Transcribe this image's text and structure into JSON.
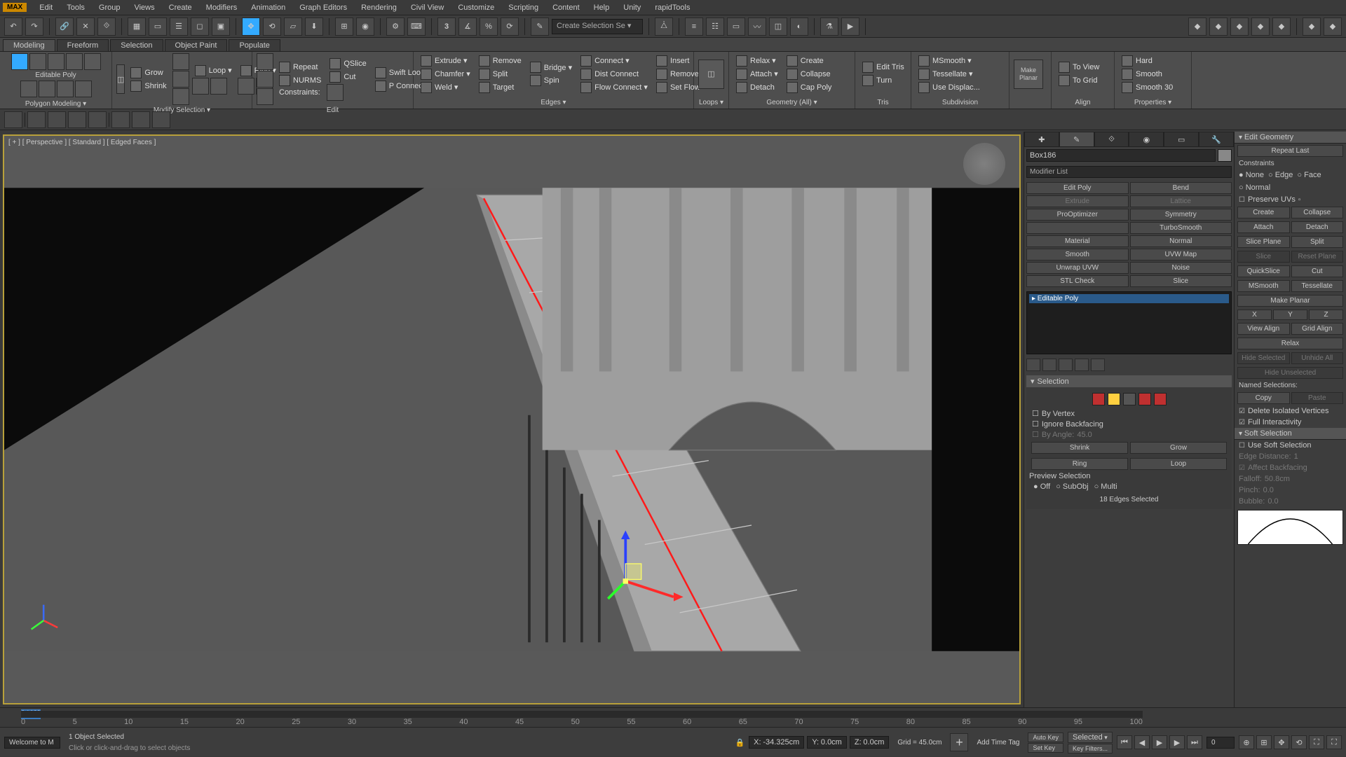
{
  "menu": {
    "logo": "MAX",
    "items": [
      "Edit",
      "Tools",
      "Group",
      "Views",
      "Create",
      "Modifiers",
      "Animation",
      "Graph Editors",
      "Rendering",
      "Civil View",
      "Customize",
      "Scripting",
      "Content",
      "Help",
      "Unity",
      "rapidTools"
    ]
  },
  "toolbar": {
    "selection_set_placeholder": "Create Selection Se"
  },
  "tabs": {
    "items": [
      "Modeling",
      "Freeform",
      "Selection",
      "Object Paint",
      "Populate"
    ],
    "active": 0
  },
  "ribbon": {
    "polygon_modeling": {
      "label": "Polygon Modeling ▾",
      "mode": "Editable Poly"
    },
    "modify": {
      "label": "Modify Selection ▾",
      "grow": "Grow",
      "shrink": "Shrink",
      "loop": "Loop ▾",
      "ring": "Ring ▾"
    },
    "edit": {
      "label": "Edit",
      "repeat": "Repeat",
      "nurms": "NURMS",
      "constraints": "Constraints:",
      "qslice": "QSlice",
      "cut": "Cut",
      "swiftloop": "Swift Loop",
      "pconnect": "P Connect ▾"
    },
    "edges": {
      "label": "Edges ▾",
      "extrude": "Extrude ▾",
      "chamfer": "Chamfer ▾",
      "weld": "Weld ▾",
      "remove": "Remove",
      "split": "Split",
      "target": "Target",
      "bridge": "Bridge ▾",
      "spin": "Spin",
      "connect": "Connect ▾",
      "distconnect": "Dist Connect",
      "flowconnect": "Flow Connect ▾",
      "insert": "Insert",
      "remove2": "Remove",
      "setflow": "Set Flow"
    },
    "loops": {
      "label": "Loops ▾"
    },
    "geometry": {
      "label": "Geometry (All) ▾",
      "relax": "Relax ▾",
      "attach": "Attach ▾",
      "detach": "Detach",
      "create": "Create",
      "collapse": "Collapse",
      "cappoly": "Cap Poly"
    },
    "tris": {
      "label": "Tris",
      "edittris": "Edit Tris",
      "turn": "Turn"
    },
    "subdivision": {
      "label": "Subdivision",
      "msmooth": "MSmooth ▾",
      "tessellate": "Tessellate ▾",
      "usedisplac": "Use Displac..."
    },
    "make_planar": {
      "label": "Make Planar",
      "btn": "Make\nPlanar"
    },
    "align": {
      "label": "Align",
      "toview": "To View",
      "togrid": "To Grid"
    },
    "properties": {
      "label": "Properties ▾",
      "hard": "Hard",
      "smooth": "Smooth",
      "smooth30": "Smooth 30"
    }
  },
  "viewport": {
    "label": "[ + ] [ Perspective ] [ Standard ] [ Edged Faces ]"
  },
  "modify_panel": {
    "object_name": "Box186",
    "modifier_list_label": "Modifier List",
    "modifier_buttons": [
      "Edit Poly",
      "Bend",
      "Extrude",
      "Lattice",
      "ProOptimizer",
      "Symmetry",
      "",
      "TurboSmooth",
      "Material",
      "Normal",
      "Smooth",
      "UVW Map",
      "Unwrap UVW",
      "Noise",
      "STL Check",
      "Slice"
    ],
    "stack_item": "▸ Editable Poly",
    "rollouts": {
      "selection": {
        "title": "Selection",
        "by_vertex": "By Vertex",
        "ignore_backfacing": "Ignore Backfacing",
        "by_angle": "By Angle:",
        "by_angle_val": "45.0",
        "shrink": "Shrink",
        "grow": "Grow",
        "ring": "Ring",
        "loop": "Loop",
        "preview": "Preview Selection",
        "radios": [
          "Off",
          "SubObj",
          "Multi"
        ],
        "status": "18 Edges Selected"
      }
    }
  },
  "right_panel": {
    "edit_geometry": {
      "title": "Edit Geometry",
      "repeat_last": "Repeat Last",
      "constraints": "Constraints",
      "c_none": "None",
      "c_edge": "Edge",
      "c_face": "Face",
      "c_normal": "Normal",
      "preserve_uvs": "Preserve UVs",
      "create": "Create",
      "collapse": "Collapse",
      "attach": "Attach",
      "detach": "Detach",
      "slice_plane": "Slice Plane",
      "split": "Split",
      "slice": "Slice",
      "reset_plane": "Reset Plane",
      "quickslice": "QuickSlice",
      "cut": "Cut",
      "msmooth": "MSmooth",
      "tessellate": "Tessellate",
      "make_planar": "Make Planar",
      "x": "X",
      "y": "Y",
      "z": "Z",
      "view_align": "View Align",
      "grid_align": "Grid Align",
      "relax": "Relax",
      "hide_selected": "Hide Selected",
      "unhide_all": "Unhide All",
      "hide_unselected": "Hide Unselected",
      "named_selections": "Named Selections:",
      "copy": "Copy",
      "paste": "Paste",
      "delete_isolated": "Delete Isolated Vertices",
      "full_interactivity": "Full Interactivity"
    },
    "soft_selection": {
      "title": "Soft Selection",
      "use": "Use Soft Selection",
      "edge_distance": "Edge Distance:",
      "edge_val": "1",
      "affect_backfacing": "Affect Backfacing",
      "falloff": "Falloff:",
      "falloff_val": "50.8cm",
      "pinch": "Pinch:",
      "pinch_val": "0.0",
      "bubble": "Bubble:",
      "bubble_val": "0.0"
    }
  },
  "timeline": {
    "frame_label": "0 / 100",
    "ticks": [
      "0",
      "5",
      "10",
      "15",
      "20",
      "25",
      "30",
      "35",
      "40",
      "45",
      "50",
      "55",
      "60",
      "65",
      "70",
      "75",
      "80",
      "85",
      "90",
      "95",
      "100"
    ]
  },
  "status": {
    "welcome": "Welcome to M",
    "selected": "1 Object Selected",
    "hint": "Click or click-and-drag to select objects",
    "x_label": "X:",
    "x_val": "-34.325cm",
    "y_label": "Y:",
    "y_val": "0.0cm",
    "z_label": "Z:",
    "z_val": "0.0cm",
    "grid_label": "Grid = 45.0cm",
    "auto_key": "Auto Key",
    "set_key": "Set Key",
    "sel_dropdown": "Selected",
    "key_filters": "Key Filters...",
    "add_time_tag": "Add Time Tag",
    "spinner": "0"
  }
}
